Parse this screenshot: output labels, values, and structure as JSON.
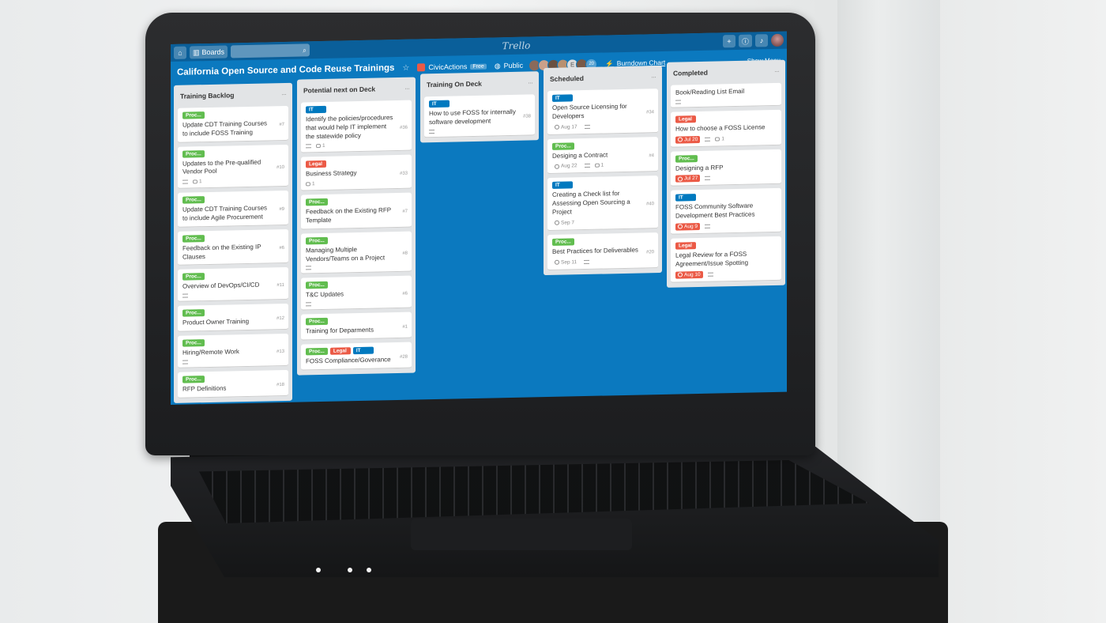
{
  "colors": {
    "board_blue": "#0b79bf",
    "topbar": "#0a5f9a",
    "list_bg": "#e2e4e6",
    "label_green": "#61bd4f",
    "label_red": "#eb5a46",
    "label_blue": "#0079bf"
  },
  "topbar": {
    "boards_label": "Boards",
    "search_placeholder": "",
    "logo": "Trello"
  },
  "board": {
    "title": "California Open Source and Code Reuse Trainings",
    "org_name": "CivicActions",
    "org_badge": "Free",
    "visibility": "Public",
    "member_initial": "E",
    "member_count": "20",
    "burndown_label": "Burndown Chart",
    "show_menu": "Show Menu"
  },
  "lists": [
    {
      "title": "Training Backlog",
      "cards": [
        {
          "labels": [
            {
              "text": "Proc...",
              "color": "#61bd4f"
            }
          ],
          "title": "Update CDT Training Courses to include FOSS Training",
          "num": "#7",
          "due": "",
          "overdue": false,
          "comments": "",
          "desc": false
        },
        {
          "labels": [
            {
              "text": "Proc...",
              "color": "#61bd4f"
            }
          ],
          "title": "Updates to the Pre-qualified Vendor Pool",
          "num": "#10",
          "due": "",
          "overdue": false,
          "comments": "1",
          "desc": true
        },
        {
          "labels": [
            {
              "text": "Proc...",
              "color": "#61bd4f"
            }
          ],
          "title": "Update CDT Training Courses to include Agile Procurement",
          "num": "#9",
          "due": "",
          "overdue": false,
          "comments": "",
          "desc": false
        },
        {
          "labels": [
            {
              "text": "Proc...",
              "color": "#61bd4f"
            }
          ],
          "title": "Feedback on the Existing IP Clauses",
          "num": "#6",
          "due": "",
          "overdue": false,
          "comments": "",
          "desc": false
        },
        {
          "labels": [
            {
              "text": "Proc...",
              "color": "#61bd4f"
            }
          ],
          "title": "Overview of DevOps/CI/CD",
          "num": "#11",
          "due": "",
          "overdue": false,
          "comments": "",
          "desc": true
        },
        {
          "labels": [
            {
              "text": "Proc...",
              "color": "#61bd4f"
            }
          ],
          "title": "Product Owner Training",
          "num": "#12",
          "due": "",
          "overdue": false,
          "comments": "",
          "desc": false
        },
        {
          "labels": [
            {
              "text": "Proc...",
              "color": "#61bd4f"
            }
          ],
          "title": "Hiring/Remote Work",
          "num": "#13",
          "due": "",
          "overdue": false,
          "comments": "",
          "desc": true
        },
        {
          "labels": [
            {
              "text": "Proc...",
              "color": "#61bd4f"
            }
          ],
          "title": "RFP Definitions",
          "num": "#18",
          "due": "",
          "overdue": false,
          "comments": "",
          "desc": false
        }
      ]
    },
    {
      "title": "Potential next on Deck",
      "cards": [
        {
          "labels": [
            {
              "text": "IT",
              "color": "#0079bf"
            }
          ],
          "title": "Identify the policies/procedures that would help IT implement the statewide policy",
          "num": "#36",
          "due": "",
          "overdue": false,
          "comments": "1",
          "desc": true
        },
        {
          "labels": [
            {
              "text": "Legal",
              "color": "#eb5a46"
            }
          ],
          "title": "Business Strategy",
          "num": "#33",
          "due": "",
          "overdue": false,
          "comments": "1",
          "desc": false
        },
        {
          "labels": [
            {
              "text": "Proc...",
              "color": "#61bd4f"
            }
          ],
          "title": "Feedback on the Existing RFP Template",
          "num": "#7",
          "due": "",
          "overdue": false,
          "comments": "",
          "desc": false
        },
        {
          "labels": [
            {
              "text": "Proc...",
              "color": "#61bd4f"
            }
          ],
          "title": "Managing Multiple Vendors/Teams on a Project",
          "num": "#8",
          "due": "",
          "overdue": false,
          "comments": "",
          "desc": true
        },
        {
          "labels": [
            {
              "text": "Proc...",
              "color": "#61bd4f"
            }
          ],
          "title": "T&C Updates",
          "num": "#6",
          "due": "",
          "overdue": false,
          "comments": "",
          "desc": true
        },
        {
          "labels": [
            {
              "text": "Proc...",
              "color": "#61bd4f"
            }
          ],
          "title": "Training for Deparments",
          "num": "#1",
          "due": "",
          "overdue": false,
          "comments": "",
          "desc": false
        },
        {
          "labels": [
            {
              "text": "Proc...",
              "color": "#61bd4f"
            },
            {
              "text": "Legal",
              "color": "#eb5a46"
            },
            {
              "text": "IT",
              "color": "#0079bf"
            }
          ],
          "title": "FOSS Compliance/Goverance",
          "num": "#28",
          "due": "",
          "overdue": false,
          "comments": "",
          "desc": false
        }
      ]
    },
    {
      "title": "Training On Deck",
      "cards": [
        {
          "labels": [
            {
              "text": "IT",
              "color": "#0079bf"
            }
          ],
          "title": "How to use FOSS for internally software development",
          "num": "#38",
          "due": "",
          "overdue": false,
          "comments": "",
          "desc": true
        }
      ]
    },
    {
      "title": "Scheduled",
      "cards": [
        {
          "labels": [
            {
              "text": "IT",
              "color": "#0079bf"
            }
          ],
          "title": "Open Source Licensing for Developers",
          "num": "#34",
          "due": "Aug 17",
          "overdue": false,
          "comments": "",
          "desc": true
        },
        {
          "labels": [
            {
              "text": "Proc...",
              "color": "#61bd4f"
            }
          ],
          "title": "Desiging a Contract",
          "num": "#4",
          "due": "Aug 22",
          "overdue": false,
          "comments": "1",
          "desc": true
        },
        {
          "labels": [
            {
              "text": "IT",
              "color": "#0079bf"
            }
          ],
          "title": "Creating a Check list for Assessing Open Sourcing a Project",
          "num": "#40",
          "due": "Sep 7",
          "overdue": false,
          "comments": "",
          "desc": false
        },
        {
          "labels": [
            {
              "text": "Proc...",
              "color": "#61bd4f"
            }
          ],
          "title": "Best Practices for Deliverables",
          "num": "#20",
          "due": "Sep 11",
          "overdue": false,
          "comments": "",
          "desc": true
        }
      ]
    },
    {
      "title": "Completed",
      "cards": [
        {
          "labels": [],
          "title": "Book/Reading List Email",
          "num": "",
          "due": "",
          "overdue": false,
          "comments": "",
          "desc": true
        },
        {
          "labels": [
            {
              "text": "Legal",
              "color": "#eb5a46"
            }
          ],
          "title": "How to choose a FOSS License",
          "num": "",
          "due": "Jul 20",
          "overdue": true,
          "comments": "1",
          "desc": true
        },
        {
          "labels": [
            {
              "text": "Proc...",
              "color": "#61bd4f"
            }
          ],
          "title": "Designing a RFP",
          "num": "",
          "due": "Jul 27",
          "overdue": true,
          "comments": "",
          "desc": true
        },
        {
          "labels": [
            {
              "text": "IT",
              "color": "#0079bf"
            }
          ],
          "title": "FOSS Community Software Development Best Practices",
          "num": "",
          "due": "Aug 9",
          "overdue": true,
          "comments": "",
          "desc": true
        },
        {
          "labels": [
            {
              "text": "Legal",
              "color": "#eb5a46"
            }
          ],
          "title": "Legal Review for a FOSS Agreement/Issue Spotting",
          "num": "",
          "due": "Aug 10",
          "overdue": true,
          "comments": "",
          "desc": true
        }
      ]
    }
  ]
}
